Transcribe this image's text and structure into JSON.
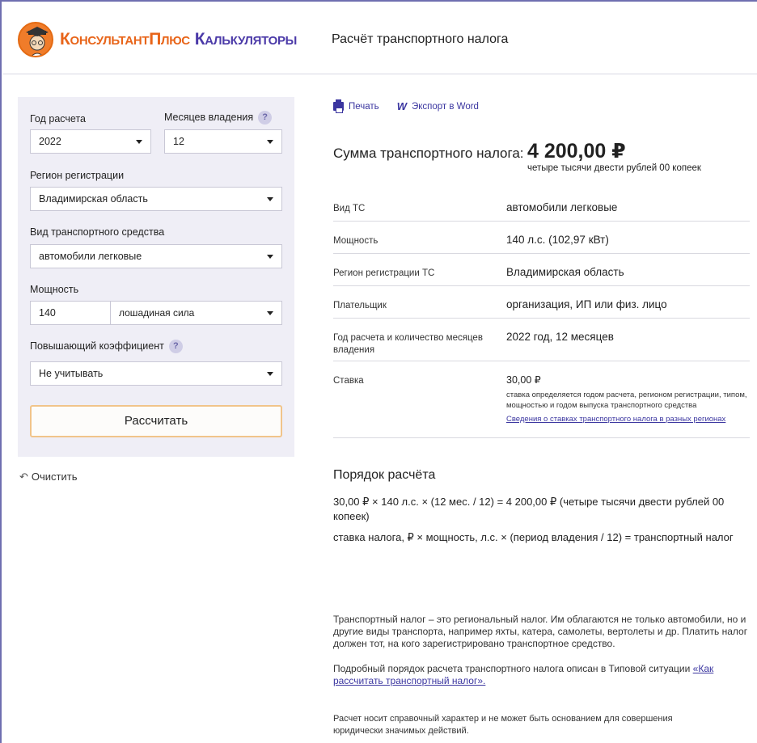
{
  "header": {
    "logo_part1": "КонсультантПлюс",
    "logo_part2": "Калькуляторы",
    "title": "Расчёт транспортного налога"
  },
  "form": {
    "year_label": "Год расчета",
    "year_value": "2022",
    "months_label": "Месяцев владения",
    "months_help": "?",
    "months_value": "12",
    "region_label": "Регион регистрации",
    "region_value": "Владимирская область",
    "vehicle_type_label": "Вид транспортного средства",
    "vehicle_type_value": "автомобили легковые",
    "power_label": "Мощность",
    "power_value": "140",
    "power_unit_value": "лошадиная сила",
    "coef_label": "Повышающий коэффициент",
    "coef_help": "?",
    "coef_value": "Не учитывать",
    "calc_button": "Рассчитать",
    "clear_icon": "↶",
    "clear_label": "Очистить"
  },
  "toolbar": {
    "print_label": "Печать",
    "word_icon": "W",
    "word_label": "Экспорт в Word"
  },
  "result": {
    "sum_label": "Сумма транспортного налога:",
    "sum_value": "4 200,00 ₽",
    "sum_words": "четыре тысячи двести рублей 00 копеек",
    "rows": [
      {
        "label": "Вид ТС",
        "value": "автомобили легковые"
      },
      {
        "label": "Мощность",
        "value": "140 л.с. (102,97 кВт)"
      },
      {
        "label": "Регион регистрации ТС",
        "value": "Владимирская область"
      },
      {
        "label": "Плательщик",
        "value": "организация, ИП или физ. лицо"
      },
      {
        "label": "Год расчета и количество месяцев владения",
        "value": "2022 год, 12 месяцев"
      },
      {
        "label": "Ставка",
        "value": "30,00 ₽"
      }
    ],
    "rate_note": "ставка определяется годом расчета, регионом регистрации, типом, мощностью и годом выпуска транспортного средства",
    "rate_link": "Сведения о ставках транспортного налога в разных регионах"
  },
  "order": {
    "title": "Порядок расчёта",
    "formula_values": "30,00 ₽ × 140 л.с. × (12 мес. / 12) = 4 200,00 ₽ (четыре тысячи двести рублей 00 копеек)",
    "formula_words": "ставка налога, ₽ × мощность, л.с. × (период владения / 12) = транспортный налог"
  },
  "info": {
    "paragraph1": "Транспортный налог – это региональный налог. Им облагаются не только автомобили, но и другие виды транспорта, например яхты, катера, самолеты, вертолеты и др. Платить налог должен тот, на кого зарегистрировано транспортное средство.",
    "paragraph2_text": "Подробный порядок расчета транспортного налога описан в Типовой ситуации ",
    "paragraph2_link": "«Как рассчитать транспортный налог».",
    "disclaimer": "Расчет носит справочный характер и не может быть основанием для совершения юридически значимых действий."
  },
  "colors": {
    "brand_orange": "#e8651a",
    "brand_purple": "#4b3aa8",
    "link": "#3b36a0",
    "panel_bg": "#efeef6",
    "button_border": "#f1c48a"
  }
}
